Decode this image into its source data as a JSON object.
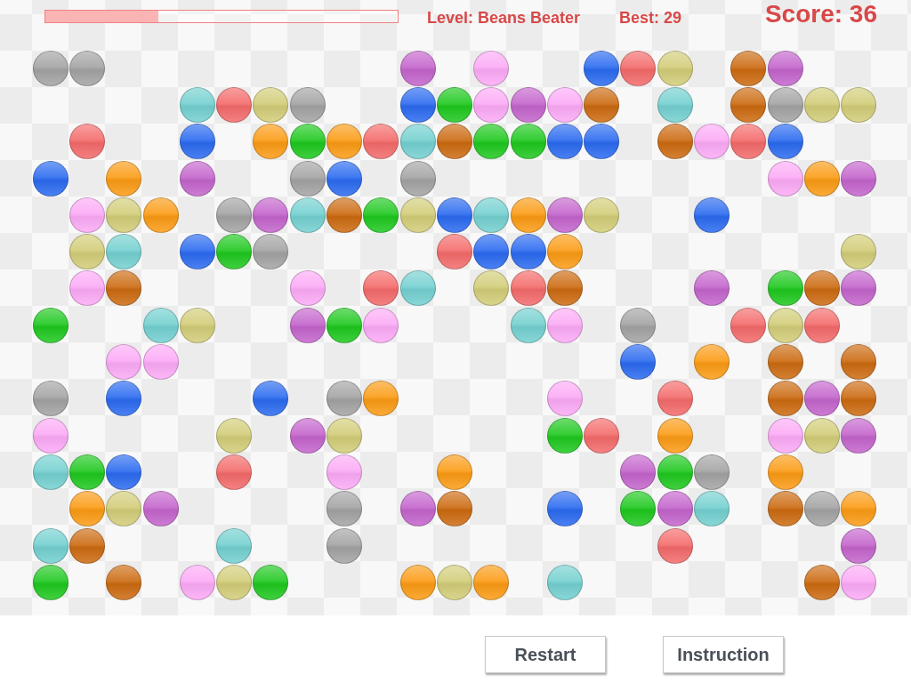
{
  "header": {
    "progress": {
      "level": 0.32
    },
    "level_label": "Level: Beans Beater",
    "best_label": "Best: 29",
    "score_label": "Score: 36"
  },
  "board": {
    "rows": [
      {
        "cells": [
          {
            "color": "#a3a3a3"
          },
          {
            "color": "#a3a3a3"
          },
          null,
          null,
          null,
          null,
          null,
          null,
          null,
          null,
          {
            "color": "#c464cc"
          },
          null,
          {
            "color": "#fcaaf6"
          },
          null,
          null,
          {
            "color": "#2a6af0"
          },
          {
            "color": "#f46a6a"
          },
          {
            "color": "#d2cd78"
          },
          null,
          {
            "color": "#cc6a10"
          },
          {
            "color": "#c464cc"
          },
          null,
          null
        ]
      },
      {
        "cells": [
          null,
          null,
          null,
          null,
          {
            "color": "#74d0d0"
          },
          {
            "color": "#f46a6a"
          },
          {
            "color": "#d2cd78"
          },
          {
            "color": "#a3a3a3"
          },
          null,
          null,
          {
            "color": "#2a6af0"
          },
          {
            "color": "#1ec81e"
          },
          {
            "color": "#fcaaf6"
          },
          {
            "color": "#c464cc"
          },
          {
            "color": "#fcaaf6"
          },
          {
            "color": "#cc6a10"
          },
          null,
          {
            "color": "#74d0d0"
          },
          null,
          {
            "color": "#cc6a10"
          },
          {
            "color": "#a3a3a3"
          },
          {
            "color": "#d2cd78"
          },
          {
            "color": "#d2cd78"
          }
        ]
      },
      {
        "cells": [
          null,
          {
            "color": "#f46a6a"
          },
          null,
          null,
          {
            "color": "#2a6af0"
          },
          null,
          {
            "color": "#fb9b14"
          },
          {
            "color": "#1ec81e"
          },
          {
            "color": "#fb9b14"
          },
          {
            "color": "#f46a6a"
          },
          {
            "color": "#74d0d0"
          },
          {
            "color": "#cc6a10"
          },
          {
            "color": "#1ec81e"
          },
          {
            "color": "#1ec81e"
          },
          {
            "color": "#2a6af0"
          },
          {
            "color": "#2a6af0"
          },
          null,
          {
            "color": "#cc6a10"
          },
          {
            "color": "#fcaaf6"
          },
          {
            "color": "#f46a6a"
          },
          {
            "color": "#2a6af0"
          },
          null,
          null
        ]
      },
      {
        "cells": [
          {
            "color": "#2a6af0"
          },
          null,
          {
            "color": "#fb9b14"
          },
          null,
          {
            "color": "#c464cc"
          },
          null,
          null,
          {
            "color": "#a3a3a3"
          },
          {
            "color": "#2a6af0"
          },
          null,
          {
            "color": "#a3a3a3"
          },
          null,
          null,
          null,
          null,
          null,
          null,
          null,
          null,
          null,
          {
            "color": "#fcaaf6"
          },
          {
            "color": "#fb9b14"
          },
          {
            "color": "#c464cc"
          }
        ]
      },
      {
        "cells": [
          null,
          {
            "color": "#fcaaf6"
          },
          {
            "color": "#d2cd78"
          },
          {
            "color": "#fb9b14"
          },
          null,
          {
            "color": "#a3a3a3"
          },
          {
            "color": "#c464cc"
          },
          {
            "color": "#74d0d0"
          },
          {
            "color": "#cc6a10"
          },
          {
            "color": "#1ec81e"
          },
          {
            "color": "#d2cd78"
          },
          {
            "color": "#2a6af0"
          },
          {
            "color": "#74d0d0"
          },
          {
            "color": "#fb9b14"
          },
          {
            "color": "#c464cc"
          },
          {
            "color": "#d2cd78"
          },
          null,
          null,
          {
            "color": "#2a6af0"
          },
          null,
          null,
          null,
          null
        ]
      },
      {
        "cells": [
          null,
          {
            "color": "#d2cd78"
          },
          {
            "color": "#74d0d0"
          },
          null,
          {
            "color": "#2a6af0"
          },
          {
            "color": "#1ec81e"
          },
          {
            "color": "#a3a3a3"
          },
          null,
          null,
          null,
          null,
          {
            "color": "#f46a6a"
          },
          {
            "color": "#2a6af0"
          },
          {
            "color": "#2a6af0"
          },
          {
            "color": "#fb9b14"
          },
          null,
          null,
          null,
          null,
          null,
          null,
          null,
          {
            "color": "#d2cd78"
          }
        ]
      },
      {
        "cells": [
          null,
          {
            "color": "#fcaaf6"
          },
          {
            "color": "#cc6a10"
          },
          null,
          null,
          null,
          null,
          {
            "color": "#fcaaf6"
          },
          null,
          {
            "color": "#f46a6a"
          },
          {
            "color": "#74d0d0"
          },
          null,
          {
            "color": "#d2cd78"
          },
          {
            "color": "#f46a6a"
          },
          {
            "color": "#cc6a10"
          },
          null,
          null,
          null,
          {
            "color": "#c464cc"
          },
          null,
          {
            "color": "#1ec81e"
          },
          {
            "color": "#cc6a10"
          },
          {
            "color": "#c464cc"
          }
        ]
      },
      {
        "cells": [
          {
            "color": "#1ec81e"
          },
          null,
          null,
          {
            "color": "#74d0d0"
          },
          {
            "color": "#d2cd78"
          },
          null,
          null,
          {
            "color": "#c464cc"
          },
          {
            "color": "#1ec81e"
          },
          {
            "color": "#fcaaf6"
          },
          null,
          null,
          null,
          {
            "color": "#74d0d0"
          },
          {
            "color": "#fcaaf6"
          },
          null,
          {
            "color": "#a3a3a3"
          },
          null,
          null,
          {
            "color": "#f46a6a"
          },
          {
            "color": "#d2cd78"
          },
          {
            "color": "#f46a6a"
          },
          null
        ]
      },
      {
        "cells": [
          null,
          null,
          {
            "color": "#fcaaf6"
          },
          {
            "color": "#fcaaf6"
          },
          null,
          null,
          null,
          null,
          null,
          null,
          null,
          null,
          null,
          null,
          null,
          null,
          {
            "color": "#2a6af0"
          },
          null,
          {
            "color": "#fb9b14"
          },
          null,
          {
            "color": "#cc6a10"
          },
          null,
          {
            "color": "#cc6a10"
          }
        ]
      },
      {
        "cells": [
          {
            "color": "#a3a3a3"
          },
          null,
          {
            "color": "#2a6af0"
          },
          null,
          null,
          null,
          {
            "color": "#2a6af0"
          },
          null,
          {
            "color": "#a3a3a3"
          },
          {
            "color": "#fb9b14"
          },
          null,
          null,
          null,
          null,
          {
            "color": "#fcaaf6"
          },
          null,
          null,
          {
            "color": "#f46a6a"
          },
          null,
          null,
          {
            "color": "#cc6a10"
          },
          {
            "color": "#c464cc"
          },
          {
            "color": "#cc6a10"
          }
        ]
      },
      {
        "cells": [
          {
            "color": "#fcaaf6"
          },
          null,
          null,
          null,
          null,
          {
            "color": "#d2cd78"
          },
          null,
          {
            "color": "#c464cc"
          },
          {
            "color": "#d2cd78"
          },
          null,
          null,
          null,
          null,
          null,
          {
            "color": "#1ec81e"
          },
          {
            "color": "#f46a6a"
          },
          null,
          {
            "color": "#fb9b14"
          },
          null,
          null,
          {
            "color": "#fcaaf6"
          },
          {
            "color": "#d2cd78"
          },
          {
            "color": "#c464cc"
          }
        ]
      },
      {
        "cells": [
          {
            "color": "#74d0d0"
          },
          {
            "color": "#1ec81e"
          },
          {
            "color": "#2a6af0"
          },
          null,
          null,
          {
            "color": "#f46a6a"
          },
          null,
          null,
          {
            "color": "#fcaaf6"
          },
          null,
          null,
          {
            "color": "#fb9b14"
          },
          null,
          null,
          null,
          null,
          {
            "color": "#c464cc"
          },
          {
            "color": "#1ec81e"
          },
          {
            "color": "#a3a3a3"
          },
          null,
          {
            "color": "#fb9b14"
          },
          null,
          null
        ]
      },
      {
        "cells": [
          null,
          {
            "color": "#fb9b14"
          },
          {
            "color": "#d2cd78"
          },
          {
            "color": "#c464cc"
          },
          null,
          null,
          null,
          null,
          {
            "color": "#a3a3a3"
          },
          null,
          {
            "color": "#c464cc"
          },
          {
            "color": "#cc6a10"
          },
          null,
          null,
          {
            "color": "#2a6af0"
          },
          null,
          {
            "color": "#1ec81e"
          },
          {
            "color": "#c464cc"
          },
          {
            "color": "#74d0d0"
          },
          null,
          {
            "color": "#cc6a10"
          },
          {
            "color": "#a3a3a3"
          },
          {
            "color": "#fb9b14"
          }
        ]
      },
      {
        "cells": [
          {
            "color": "#74d0d0"
          },
          {
            "color": "#cc6a10"
          },
          null,
          null,
          null,
          {
            "color": "#74d0d0"
          },
          null,
          null,
          {
            "color": "#a3a3a3"
          },
          null,
          null,
          null,
          null,
          null,
          null,
          null,
          null,
          {
            "color": "#f46a6a"
          },
          null,
          null,
          null,
          null,
          {
            "color": "#c464cc"
          }
        ]
      },
      {
        "cells": [
          {
            "color": "#1ec81e"
          },
          null,
          {
            "color": "#cc6a10"
          },
          null,
          {
            "color": "#fcaaf6"
          },
          {
            "color": "#d2cd78"
          },
          {
            "color": "#1ec81e"
          },
          null,
          null,
          null,
          {
            "color": "#fb9b14"
          },
          {
            "color": "#d2cd78"
          },
          {
            "color": "#fb9b14"
          },
          null,
          {
            "color": "#74d0d0"
          },
          null,
          null,
          null,
          null,
          null,
          null,
          {
            "color": "#cc6a10"
          },
          {
            "color": "#fcaaf6"
          }
        ]
      }
    ]
  },
  "buttons": [
    {
      "label": "Restart"
    },
    {
      "label": "Instruction"
    }
  ]
}
